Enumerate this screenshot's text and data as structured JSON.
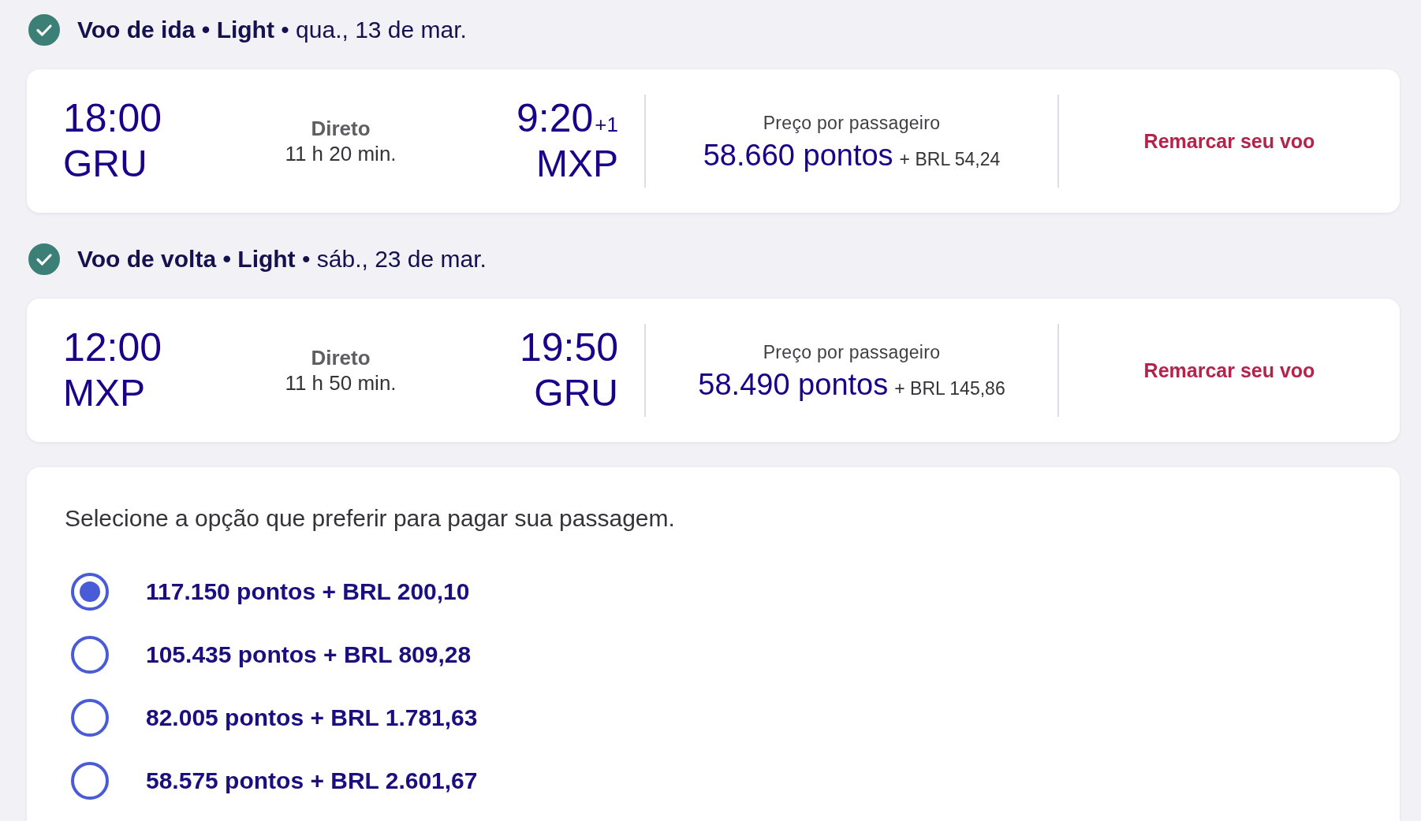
{
  "flights": [
    {
      "completed": true,
      "heading": "**Voo de ida • Light** • qua., 13 de mar.",
      "departure": {
        "time": "18:00",
        "airport": "GRU"
      },
      "stops": "Direto",
      "duration": "11 h 20 min.",
      "arrival": {
        "time": "9:20",
        "day_offset": "+1",
        "airport": "MXP"
      },
      "price_label": "Preço por passageiro",
      "price_points": "58.660 pontos",
      "price_fee": "+ BRL 54,24",
      "action": "Remarcar seu voo"
    },
    {
      "completed": true,
      "heading": "**Voo de volta • Light** • sáb., 23 de mar.",
      "departure": {
        "time": "12:00",
        "airport": "MXP"
      },
      "stops": "Direto",
      "duration": "11 h 50 min.",
      "arrival": {
        "time": "19:50",
        "airport": "GRU"
      },
      "price_label": "Preço por passageiro",
      "price_points": "58.490 pontos",
      "price_fee": "+ BRL 145,86",
      "action": "Remarcar seu voo"
    }
  ],
  "payment": {
    "prompt": "Selecione a opção que preferir para pagar sua passagem.",
    "options": [
      {
        "label": "117.150 pontos + BRL 200,10",
        "selected": true
      },
      {
        "label": "105.435 pontos + BRL 809,28",
        "selected": false
      },
      {
        "label": "82.005 pontos + BRL 1.781,63",
        "selected": false
      },
      {
        "label": "58.575 pontos + BRL 2.601,67",
        "selected": false
      }
    ]
  }
}
